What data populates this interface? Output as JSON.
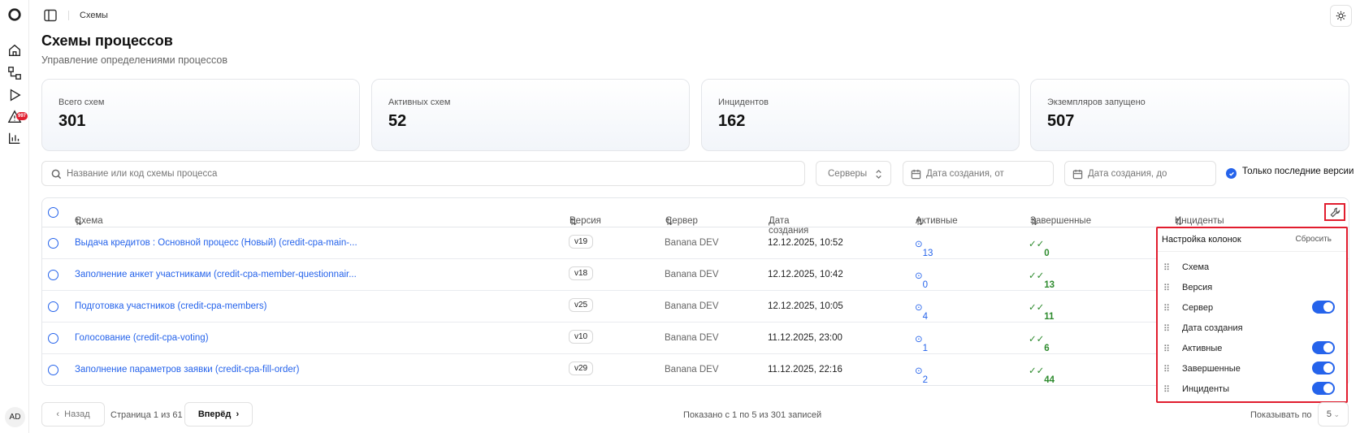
{
  "breadcrumb": "Схемы",
  "page": {
    "title": "Схемы процессов",
    "subtitle": "Управление определениями процессов"
  },
  "stats": [
    {
      "label": "Всего схем",
      "value": "301"
    },
    {
      "label": "Активных схем",
      "value": "52"
    },
    {
      "label": "Инцидентов",
      "value": "162"
    },
    {
      "label": "Экземпляров запущено",
      "value": "507"
    }
  ],
  "sidebar": {
    "badge": "997",
    "avatar": "AD"
  },
  "filters": {
    "search_placeholder": "Название или код схемы процесса",
    "servers": "Серверы",
    "date_from": "Дата создания, от",
    "date_to": "Дата создания, до",
    "latest_only": "Только последние версии"
  },
  "table": {
    "columns": [
      "Схема",
      "Версия",
      "Сервер",
      "Дата создания",
      "Активные",
      "Завершенные",
      "Инциденты"
    ],
    "rows": [
      {
        "name": "Выдача кредитов : Основной процесс (Новый) (credit-cpa-main-...",
        "version": "v19",
        "server": "Banana DEV",
        "date": "12.12.2025, 10:52",
        "active": "13",
        "done": "0"
      },
      {
        "name": "Заполнение анкет участниками (credit-cpa-member-questionnair...",
        "version": "v18",
        "server": "Banana DEV",
        "date": "12.12.2025, 10:42",
        "active": "0",
        "done": "13"
      },
      {
        "name": "Подготовка участников (credit-cpa-members)",
        "version": "v25",
        "server": "Banana DEV",
        "date": "12.12.2025, 10:05",
        "active": "4",
        "done": "11"
      },
      {
        "name": "Голосование (credit-cpa-voting)",
        "version": "v10",
        "server": "Banana DEV",
        "date": "11.12.2025, 23:00",
        "active": "1",
        "done": "6"
      },
      {
        "name": "Заполнение параметров заявки (credit-cpa-fill-order)",
        "version": "v29",
        "server": "Banana DEV",
        "date": "11.12.2025, 22:16",
        "active": "2",
        "done": "44"
      }
    ]
  },
  "column_settings": {
    "title": "Настройка колонок",
    "reset": "Сбросить",
    "items": [
      {
        "label": "Схема",
        "toggle": false
      },
      {
        "label": "Версия",
        "toggle": false
      },
      {
        "label": "Сервер",
        "toggle": true
      },
      {
        "label": "Дата создания",
        "toggle": false
      },
      {
        "label": "Активные",
        "toggle": true
      },
      {
        "label": "Завершенные",
        "toggle": true
      },
      {
        "label": "Инциденты",
        "toggle": true
      }
    ]
  },
  "pagination": {
    "back": "Назад",
    "page_info": "Страница 1 из 61",
    "next": "Вперёд",
    "summary": "Показано с 1 по 5 из 301 записей",
    "per_page_label": "Показывать по",
    "per_page": "5"
  },
  "colors": {
    "accent": "#2563eb",
    "done": "#2e8b2e",
    "highlight": "#e11d2e"
  }
}
